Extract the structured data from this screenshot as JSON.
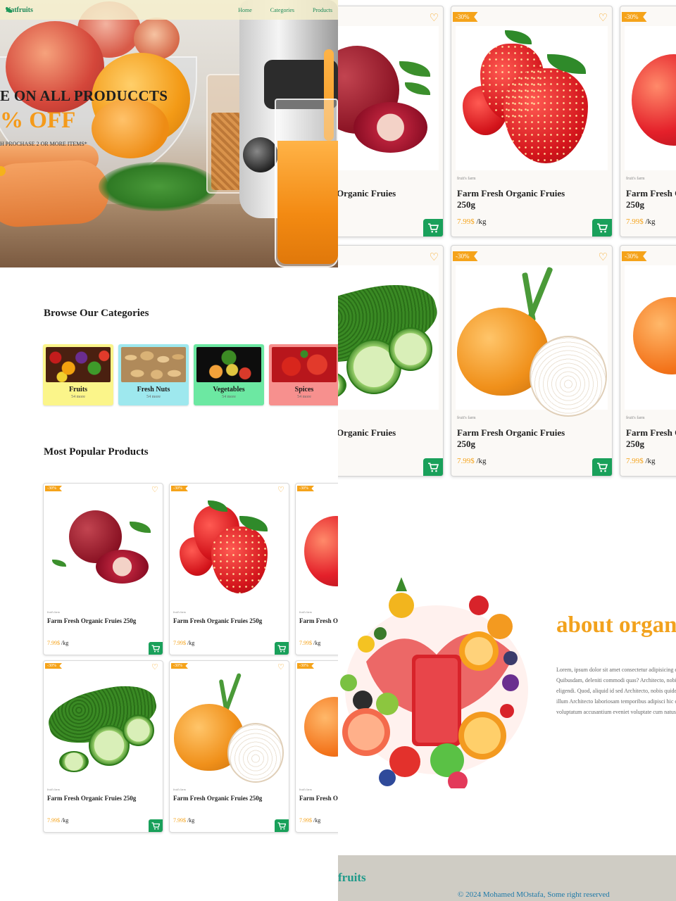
{
  "nav": {
    "logo": "Natfruits",
    "links": [
      "Home",
      "Categories",
      "Products"
    ]
  },
  "hero": {
    "headline": "E ON ALL PRODUCCTS",
    "discount": "% OFF",
    "subtext": "H PROCHASE 2 OR MORE ITEMS*"
  },
  "categories": {
    "title": "Browse Our Categories",
    "items": [
      {
        "name": "Fruits",
        "count": "54 more",
        "bg": "#fbf58a"
      },
      {
        "name": "Fresh Nuts",
        "count": "54 more",
        "bg": "#9ee8ee"
      },
      {
        "name": "Vegetables",
        "count": "54 more",
        "bg": "#6ce8a2"
      },
      {
        "name": "Spices",
        "count": "54 more",
        "bg": "#f7908e"
      }
    ]
  },
  "popular": {
    "title": "Most Popular Products",
    "badge": "-30%",
    "brand": "fruit's farm",
    "product_title": "Farm Fresh Organic Fruies 250g",
    "price": "7.99$",
    "unit": "/kg"
  },
  "about": {
    "title": "about organic",
    "text": "Lorem, ipsum dolor sit amet consectetur adipisicing elit. Quibusdam, deleniti commodi quas? Architecto, nobis eligendi. Quod, aliquid id sed Architecto, nobis quidem illum Architecto laboriosam temporibus adipisci hic eaque voluptatum accusantium eveniet voluptate cum natus."
  },
  "footer": {
    "logo": "fruits",
    "copyright": "© 2024 Mohamed MOstafa, Some right reserved"
  },
  "colors": {
    "accent": "#f5a31a",
    "green": "#19a05a"
  }
}
